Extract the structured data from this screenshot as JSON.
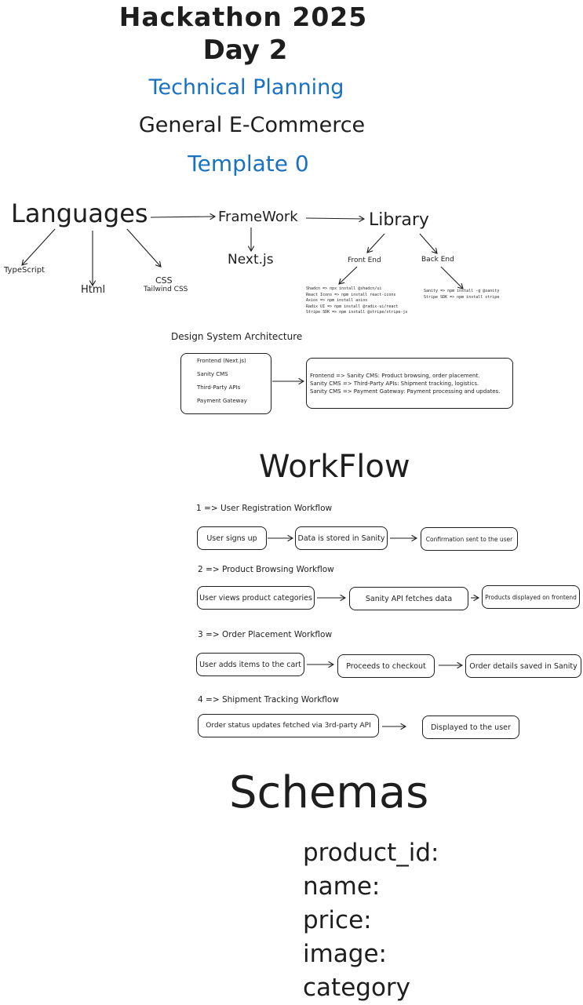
{
  "header": {
    "title": "Hackathon 2025",
    "day": "Day 2",
    "subtitle": "Technical Planning",
    "category": "General E-Commerce",
    "template": "Template 0"
  },
  "tech": {
    "languages": "Languages",
    "framework": "FrameWork",
    "library": "Library",
    "nextjs": "Next.js",
    "typescript": "TypeScript",
    "html": "Html",
    "css": "CSS",
    "tailwind": "Tailwind CSS",
    "frontend": "Front End",
    "backend": "Back End",
    "frontend_libs": [
      "Shadcn     =>  npx install @shadcn/ui",
      "React Icons =>  npm install react-icons",
      "Axios      =>  npm install axios",
      "Radix UI   =>  npm install @radix-ui/react",
      "Stripe SDK =>  npm install @stripe/stripe-js"
    ],
    "backend_libs": [
      "Sanity     =>  npm install -g @sanity",
      "Stripe SDK =>  npm install stripe"
    ]
  },
  "design": {
    "title": "Design System Architecture",
    "left_items": [
      "Frontend (Next.js)",
      "Sanity CMS",
      "Third-Party APIs",
      "Payment Gateway"
    ],
    "right_lines": [
      "Frontend     =>   Sanity CMS:           Product browsing, order placement.",
      "Sanity CMS  =>   Third-Party APIs:  Shipment tracking, logistics.",
      "Sanity CMS  =>     Payment Gateway:   Payment processing and updates."
    ]
  },
  "workflow": {
    "title": "WorkFlow",
    "flows": [
      {
        "heading": "1 => User Registration Workflow",
        "steps": [
          "User signs up",
          "Data is stored in Sanity",
          "Confirmation sent to the user"
        ]
      },
      {
        "heading": "2 => Product Browsing Workflow",
        "steps": [
          "User views product categories",
          "Sanity API fetches data",
          "Products displayed on frontend"
        ]
      },
      {
        "heading": "3 => Order Placement Workflow",
        "steps": [
          "User adds items to the cart",
          "Proceeds to checkout",
          "Order details saved in Sanity"
        ]
      },
      {
        "heading": "4 => Shipment Tracking Workflow",
        "steps": [
          "Order status updates fetched via 3rd-party API",
          "Displayed to the user"
        ]
      }
    ]
  },
  "schemas": {
    "title": "Schemas",
    "fields": [
      "product_id:",
      "name:",
      "price:",
      "image:",
      "category"
    ]
  }
}
